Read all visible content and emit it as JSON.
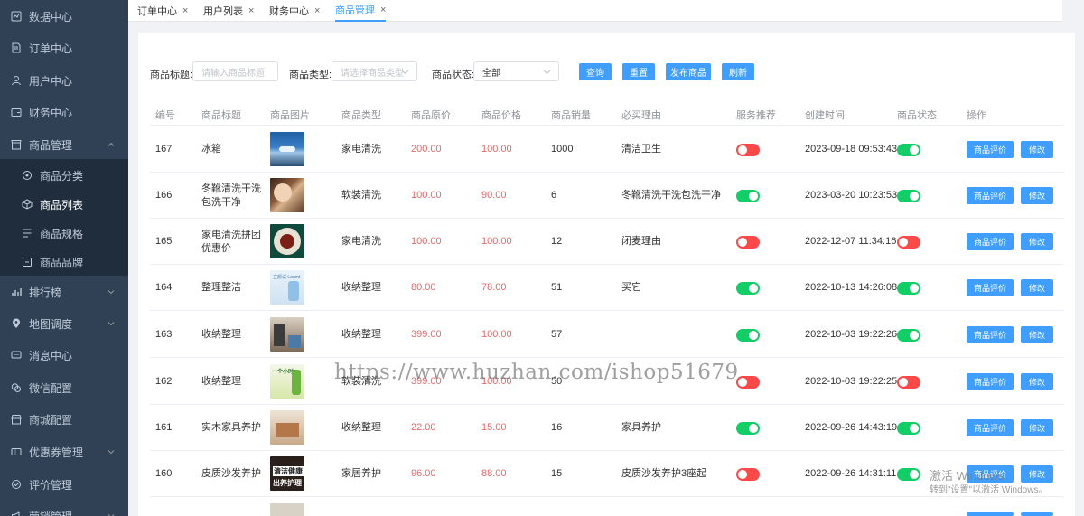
{
  "sidebar": {
    "items": [
      {
        "label": "数据中心",
        "icon": "chart-icon"
      },
      {
        "label": "订单中心",
        "icon": "document-icon"
      },
      {
        "label": "用户中心",
        "icon": "user-icon"
      },
      {
        "label": "财务中心",
        "icon": "wallet-icon"
      },
      {
        "label": "商品管理",
        "icon": "shop-icon"
      },
      {
        "label": "商品分类",
        "icon": "category-icon"
      },
      {
        "label": "商品列表",
        "icon": "box-icon"
      },
      {
        "label": "商品规格",
        "icon": "spec-icon"
      },
      {
        "label": "商品品牌",
        "icon": "brand-icon"
      },
      {
        "label": "排行榜",
        "icon": "ranking-icon"
      },
      {
        "label": "地图调度",
        "icon": "map-pin-icon"
      },
      {
        "label": "消息中心",
        "icon": "message-icon"
      },
      {
        "label": "微信配置",
        "icon": "wechat-icon"
      },
      {
        "label": "商城配置",
        "icon": "store-icon"
      },
      {
        "label": "优惠券管理",
        "icon": "coupon-icon"
      },
      {
        "label": "评价管理",
        "icon": "comment-icon"
      },
      {
        "label": "营销管理",
        "icon": "marketing-icon"
      }
    ]
  },
  "tabs": [
    {
      "label": "订单中心",
      "close": "×"
    },
    {
      "label": "用户列表",
      "close": "×"
    },
    {
      "label": "财务中心",
      "close": "×"
    },
    {
      "label": "商品管理",
      "close": "×"
    }
  ],
  "filters": {
    "title_label": "商品标题:",
    "title_placeholder": "请输入商品标题",
    "type_label": "商品类型:",
    "type_placeholder": "请选择商品类型",
    "status_label": "商品状态:",
    "status_value": "全部",
    "query_btn": "查询",
    "reset_btn": "重置",
    "publish_btn": "发布商品",
    "refresh_btn": "刷新"
  },
  "table": {
    "headers": [
      "编号",
      "商品标题",
      "商品图片",
      "商品类型",
      "商品原价",
      "商品价格",
      "商品销量",
      "必买理由",
      "服务推荐",
      "创建时间",
      "商品状态",
      "操作"
    ],
    "rows": [
      {
        "id": "167",
        "title": "冰箱",
        "type": "家电清洗",
        "orig": "200.00",
        "price": "100.00",
        "sales": "1000",
        "reason": "清洁卫生",
        "recommend": false,
        "time": "2023-09-18 09:53:43",
        "status": true
      },
      {
        "id": "166",
        "title": "冬靴清洗干洗包洗干净",
        "type": "软装清洗",
        "orig": "100.00",
        "price": "90.00",
        "sales": "6",
        "reason": "冬靴清洗干洗包洗干净",
        "recommend": true,
        "time": "2023-03-20 10:23:53",
        "status": true
      },
      {
        "id": "165",
        "title": "家电清洗拼团优惠价",
        "type": "家电清洗",
        "orig": "100.00",
        "price": "100.00",
        "sales": "12",
        "reason": "闭麦理由",
        "recommend": false,
        "time": "2022-12-07 11:34:16",
        "status": false
      },
      {
        "id": "164",
        "title": "整理整洁",
        "type": "收纳整理",
        "orig": "80.00",
        "price": "78.00",
        "sales": "51",
        "reason": "买它",
        "recommend": true,
        "time": "2022-10-13 14:26:08",
        "status": true
      },
      {
        "id": "163",
        "title": "收纳整理",
        "type": "收纳整理",
        "orig": "399.00",
        "price": "100.00",
        "sales": "57",
        "reason": "",
        "recommend": true,
        "time": "2022-10-03 19:22:26",
        "status": true
      },
      {
        "id": "162",
        "title": "收纳整理",
        "type": "软装清洗",
        "orig": "399.00",
        "price": "100.00",
        "sales": "50",
        "reason": "",
        "recommend": false,
        "time": "2022-10-03 19:22:25",
        "status": false
      },
      {
        "id": "161",
        "title": "实木家具养护",
        "type": "收纳整理",
        "orig": "22.00",
        "price": "15.00",
        "sales": "16",
        "reason": "家具养护",
        "recommend": true,
        "time": "2022-09-26 14:43:19",
        "status": true
      },
      {
        "id": "160",
        "title": "皮质沙发养护",
        "type": "家居养护",
        "orig": "96.00",
        "price": "88.00",
        "sales": "15",
        "reason": "皮质沙发养护3座起",
        "recommend": false,
        "time": "2022-09-26 14:31:11",
        "status": true
      }
    ],
    "review_btn": "商品评价",
    "edit_btn": "修改"
  },
  "thumb_texts": {
    "t164": "立颜试 Lanmt",
    "t162": "一个小时",
    "t160_1": "清洁健康",
    "t160_2": "出养护理"
  },
  "overlay": {
    "watermark": "https://www.huzhan.com/ishop51679",
    "activate_title": "激活 Windows",
    "activate_sub": "转到\"设置\"以激活 Windows。"
  },
  "colors": {
    "sidebar_bg": "#304156",
    "primary": "#409eff",
    "switch_on": "#13ce66",
    "switch_off": "#ff4949",
    "price_red": "#e06b6b"
  }
}
